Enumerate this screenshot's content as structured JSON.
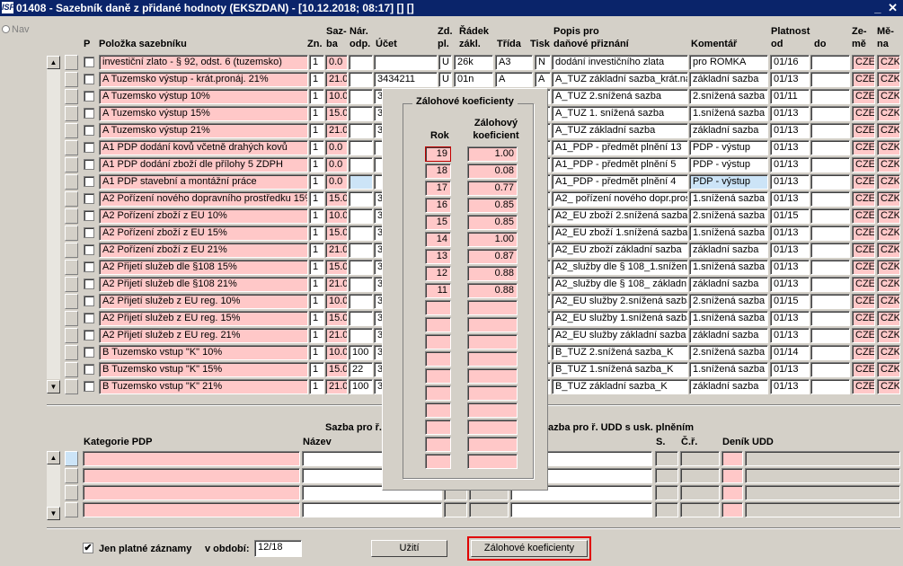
{
  "window": {
    "title": "01408 - Sazebník daně z přidané hodnoty (EKSZDAN) - [10.12.2018; 08:17] [] []",
    "logo": "ISF",
    "controls": "_ ✕"
  },
  "nav": {
    "label": "Nav"
  },
  "columns": {
    "p": "P",
    "polozka": "Položka sazebníku",
    "zn": "Zn.",
    "sazba_top": "Saz-",
    "sazba_bot": "ba",
    "nar_top": "Nár.",
    "nar_bot": "odp.",
    "ucet": "Účet",
    "zd_top": "Zd.",
    "zd_bot": "pl.",
    "radek_top": "Řádek",
    "radek_bot": "zákl.",
    "trida": "Třída",
    "tisk": "Tisk",
    "popis_top": "Popis pro",
    "popis_bot": "daňové přiznání",
    "komentar": "Komentář",
    "platnost_top": "Platnost",
    "od": "od",
    "do": "do",
    "zeme_top": "Ze-",
    "zeme_bot": "mě",
    "mena_top": "Mě-",
    "mena_bot": "na"
  },
  "rows": [
    {
      "polozka": "investiční zlato - § 92, odst. 6 (tuzemsko)",
      "zn": "1",
      "sazba": "0.0",
      "nar": "",
      "ucet": "",
      "zd": "U",
      "radek": "26k",
      "trida": "A3",
      "tisk": "N",
      "popis": "dodání investičního zlata",
      "komentar": "pro ROMKA",
      "od": "01/16",
      "do": "",
      "zeme": "CZE",
      "mena": "CZK"
    },
    {
      "polozka": "A  Tuzemsko výstup - krát.pronáj. 21%",
      "zn": "1",
      "sazba": "21.0",
      "nar": "",
      "ucet": "3434211",
      "zd": "U",
      "radek": "01n",
      "trida": "A",
      "tisk": "A",
      "popis": "A_TUZ základní sazba_krát.ná",
      "komentar": "základní sazba",
      "od": "01/13",
      "do": "",
      "zeme": "CZE",
      "mena": "CZK"
    },
    {
      "polozka": "A  Tuzemsko výstup 10%",
      "zn": "1",
      "sazba": "10.0",
      "nar": "",
      "ucet": "3",
      "zd": "",
      "radek": "",
      "trida": "",
      "tisk": "",
      "popis": "A_TUZ 2.snížená sazba",
      "komentar": "2.snížená sazba",
      "od": "01/11",
      "do": "",
      "zeme": "CZE",
      "mena": "CZK"
    },
    {
      "polozka": "A  Tuzemsko výstup 15%",
      "zn": "1",
      "sazba": "15.0",
      "nar": "",
      "ucet": "3",
      "zd": "",
      "radek": "",
      "trida": "",
      "tisk": "",
      "popis": "A_TUZ 1. snížená sazba",
      "komentar": "1.snížená sazba",
      "od": "01/13",
      "do": "",
      "zeme": "CZE",
      "mena": "CZK"
    },
    {
      "polozka": "A  Tuzemsko výstup 21%",
      "zn": "1",
      "sazba": "21.0",
      "nar": "",
      "ucet": "3",
      "zd": "",
      "radek": "",
      "trida": "",
      "tisk": "",
      "popis": "A_TUZ základní sazba",
      "komentar": "základní sazba",
      "od": "01/13",
      "do": "",
      "zeme": "CZE",
      "mena": "CZK"
    },
    {
      "polozka": "A1  PDP dodání kovů včetně drahých kovů",
      "zn": "1",
      "sazba": "0.0",
      "nar": "",
      "ucet": "",
      "zd": "",
      "radek": "",
      "trida": "",
      "tisk": "",
      "popis": "A1_PDP - předmět plnění 13",
      "komentar": "PDP - výstup",
      "od": "01/13",
      "do": "",
      "zeme": "CZE",
      "mena": "CZK"
    },
    {
      "polozka": "A1  PDP dodání zboží dle přílohy 5 ZDPH",
      "zn": "1",
      "sazba": "0.0",
      "nar": "",
      "ucet": "",
      "zd": "",
      "radek": "",
      "trida": "",
      "tisk": "",
      "popis": "A1_PDP - předmět plnění 5",
      "komentar": "PDP - výstup",
      "od": "01/13",
      "do": "",
      "zeme": "CZE",
      "mena": "CZK"
    },
    {
      "polozka": "A1  PDP stavební a montážní práce",
      "zn": "1",
      "sazba": "0.0",
      "nar": "",
      "ucet": "",
      "zd": "",
      "radek": "",
      "trida": "",
      "tisk": "",
      "popis": "A1_PDP - předmět plnění 4",
      "komentar": "PDP - výstup",
      "od": "01/13",
      "do": "",
      "zeme": "CZE",
      "mena": "CZK",
      "selected": true
    },
    {
      "polozka": "A2  Pořízení nového dopravního prostředku 15%",
      "zn": "1",
      "sazba": "15.0",
      "nar": "",
      "ucet": "3",
      "zd": "",
      "radek": "",
      "trida": "",
      "tisk": "",
      "popis": "A2_ pořízení nového dopr.pros",
      "komentar": "1.snížená sazba",
      "od": "01/13",
      "do": "",
      "zeme": "CZE",
      "mena": "CZK"
    },
    {
      "polozka": "A2  Pořízení zboží z EU 10%",
      "zn": "1",
      "sazba": "10.0",
      "nar": "",
      "ucet": "3",
      "zd": "",
      "radek": "",
      "trida": "",
      "tisk": "",
      "popis": "A2_EU zboží 2.snížená sazba",
      "komentar": "2.snížená sazba",
      "od": "01/15",
      "do": "",
      "zeme": "CZE",
      "mena": "CZK"
    },
    {
      "polozka": "A2  Pořízení zboží z EU 15%",
      "zn": "1",
      "sazba": "15.0",
      "nar": "",
      "ucet": "3",
      "zd": "",
      "radek": "",
      "trida": "",
      "tisk": "",
      "popis": "A2_EU zboží 1.snížená sazba",
      "komentar": "1.snížená sazba",
      "od": "01/13",
      "do": "",
      "zeme": "CZE",
      "mena": "CZK"
    },
    {
      "polozka": "A2  Pořízení zboží z EU 21%",
      "zn": "1",
      "sazba": "21.0",
      "nar": "",
      "ucet": "3",
      "zd": "",
      "radek": "",
      "trida": "",
      "tisk": "",
      "popis": "A2_EU zboží základní sazba",
      "komentar": "základní sazba",
      "od": "01/13",
      "do": "",
      "zeme": "CZE",
      "mena": "CZK"
    },
    {
      "polozka": "A2  Přijetí služeb dle §108 15%",
      "zn": "1",
      "sazba": "15.0",
      "nar": "",
      "ucet": "3",
      "zd": "",
      "radek": "",
      "trida": "",
      "tisk": "",
      "popis": "A2_služby dle § 108_1.snížena",
      "komentar": "1.snížená sazba",
      "od": "01/13",
      "do": "",
      "zeme": "CZE",
      "mena": "CZK"
    },
    {
      "polozka": "A2  Přijetí služeb dle §108 21%",
      "zn": "1",
      "sazba": "21.0",
      "nar": "",
      "ucet": "3",
      "zd": "",
      "radek": "",
      "trida": "",
      "tisk": "",
      "popis": "A2_služby dle § 108_ základní",
      "komentar": "základní sazba",
      "od": "01/13",
      "do": "",
      "zeme": "CZE",
      "mena": "CZK"
    },
    {
      "polozka": "A2  Přijetí služeb z EU reg. 10%",
      "zn": "1",
      "sazba": "10.0",
      "nar": "",
      "ucet": "3",
      "zd": "",
      "radek": "",
      "trida": "",
      "tisk": "",
      "popis": "A2_EU služby 2.snížená sazba",
      "komentar": "2.snížená sazba",
      "od": "01/15",
      "do": "",
      "zeme": "CZE",
      "mena": "CZK"
    },
    {
      "polozka": "A2  Přijetí služeb z EU reg. 15%",
      "zn": "1",
      "sazba": "15.0",
      "nar": "",
      "ucet": "3",
      "zd": "",
      "radek": "",
      "trida": "",
      "tisk": "",
      "popis": "A2_EU služby 1.snížená sazba",
      "komentar": "1.snížená sazba",
      "od": "01/13",
      "do": "",
      "zeme": "CZE",
      "mena": "CZK"
    },
    {
      "polozka": "A2  Přijetí služeb z EU reg. 21%",
      "zn": "1",
      "sazba": "21.0",
      "nar": "",
      "ucet": "3",
      "zd": "",
      "radek": "",
      "trida": "",
      "tisk": "",
      "popis": "A2_EU služby základní sazba",
      "komentar": "základní sazba",
      "od": "01/13",
      "do": "",
      "zeme": "CZE",
      "mena": "CZK"
    },
    {
      "polozka": "B  Tuzemsko vstup \"K\" 10%",
      "zn": "1",
      "sazba": "10.0",
      "nar": "100",
      "ucet": "3",
      "zd": "",
      "radek": "",
      "trida": "",
      "tisk": "",
      "popis": "B_TUZ 2.snížená sazba_K",
      "komentar": "2.snížená sazba",
      "od": "01/14",
      "do": "",
      "zeme": "CZE",
      "mena": "CZK"
    },
    {
      "polozka": "B  Tuzemsko vstup \"K\" 15%",
      "zn": "1",
      "sazba": "15.0",
      "nar": "22",
      "ucet": "3",
      "zd": "",
      "radek": "",
      "trida": "",
      "tisk": "",
      "popis": "B_TUZ 1.snížená sazba_K",
      "komentar": "1.snížená sazba",
      "od": "01/13",
      "do": "",
      "zeme": "CZE",
      "mena": "CZK"
    },
    {
      "polozka": "B  Tuzemsko vstup \"K\" 21%",
      "zn": "1",
      "sazba": "21.0",
      "nar": "100",
      "ucet": "3",
      "zd": "",
      "radek": "",
      "trida": "",
      "tisk": "",
      "popis": "B_TUZ základní sazba_K",
      "komentar": "základní sazba",
      "od": "01/13",
      "do": "",
      "zeme": "CZE",
      "mena": "CZK"
    }
  ],
  "lower": {
    "sazba_pro_r": "Sazba pro ř.",
    "udd_header": "azba pro ř. UDD s usk. plněním",
    "kategorie": "Kategorie PDP",
    "nazev": "Název",
    "s": "S.",
    "cr": "Č.ř.",
    "denik": "Deník UDD"
  },
  "popup": {
    "title": "Zálohové koeficienty",
    "col_rok": "Rok",
    "col_koef_top": "Zálohový",
    "col_koef_bot": "koeficient",
    "rows": [
      {
        "rok": "19",
        "koef": "1.00"
      },
      {
        "rok": "18",
        "koef": "0.08"
      },
      {
        "rok": "17",
        "koef": "0.77"
      },
      {
        "rok": "16",
        "koef": "0.85"
      },
      {
        "rok": "15",
        "koef": "0.85"
      },
      {
        "rok": "14",
        "koef": "1.00"
      },
      {
        "rok": "13",
        "koef": "0.87"
      },
      {
        "rok": "12",
        "koef": "0.88"
      },
      {
        "rok": "11",
        "koef": "0.88"
      },
      {
        "rok": "",
        "koef": ""
      },
      {
        "rok": "",
        "koef": ""
      },
      {
        "rok": "",
        "koef": ""
      },
      {
        "rok": "",
        "koef": ""
      },
      {
        "rok": "",
        "koef": ""
      },
      {
        "rok": "",
        "koef": ""
      },
      {
        "rok": "",
        "koef": ""
      },
      {
        "rok": "",
        "koef": ""
      },
      {
        "rok": "",
        "koef": ""
      },
      {
        "rok": "",
        "koef": ""
      }
    ]
  },
  "footer": {
    "only_valid_label": "Jen platné záznamy",
    "only_valid_checked": "✔",
    "period_label": "v období:",
    "period_value": "12/18",
    "uziti_button": "Užití",
    "koef_button": "Zálohové koeficienty"
  },
  "colors": {
    "pink": "#ffc8c8",
    "title_bg": "#0a246a",
    "highlight": "#e00000",
    "selected": "#cce4f7"
  }
}
